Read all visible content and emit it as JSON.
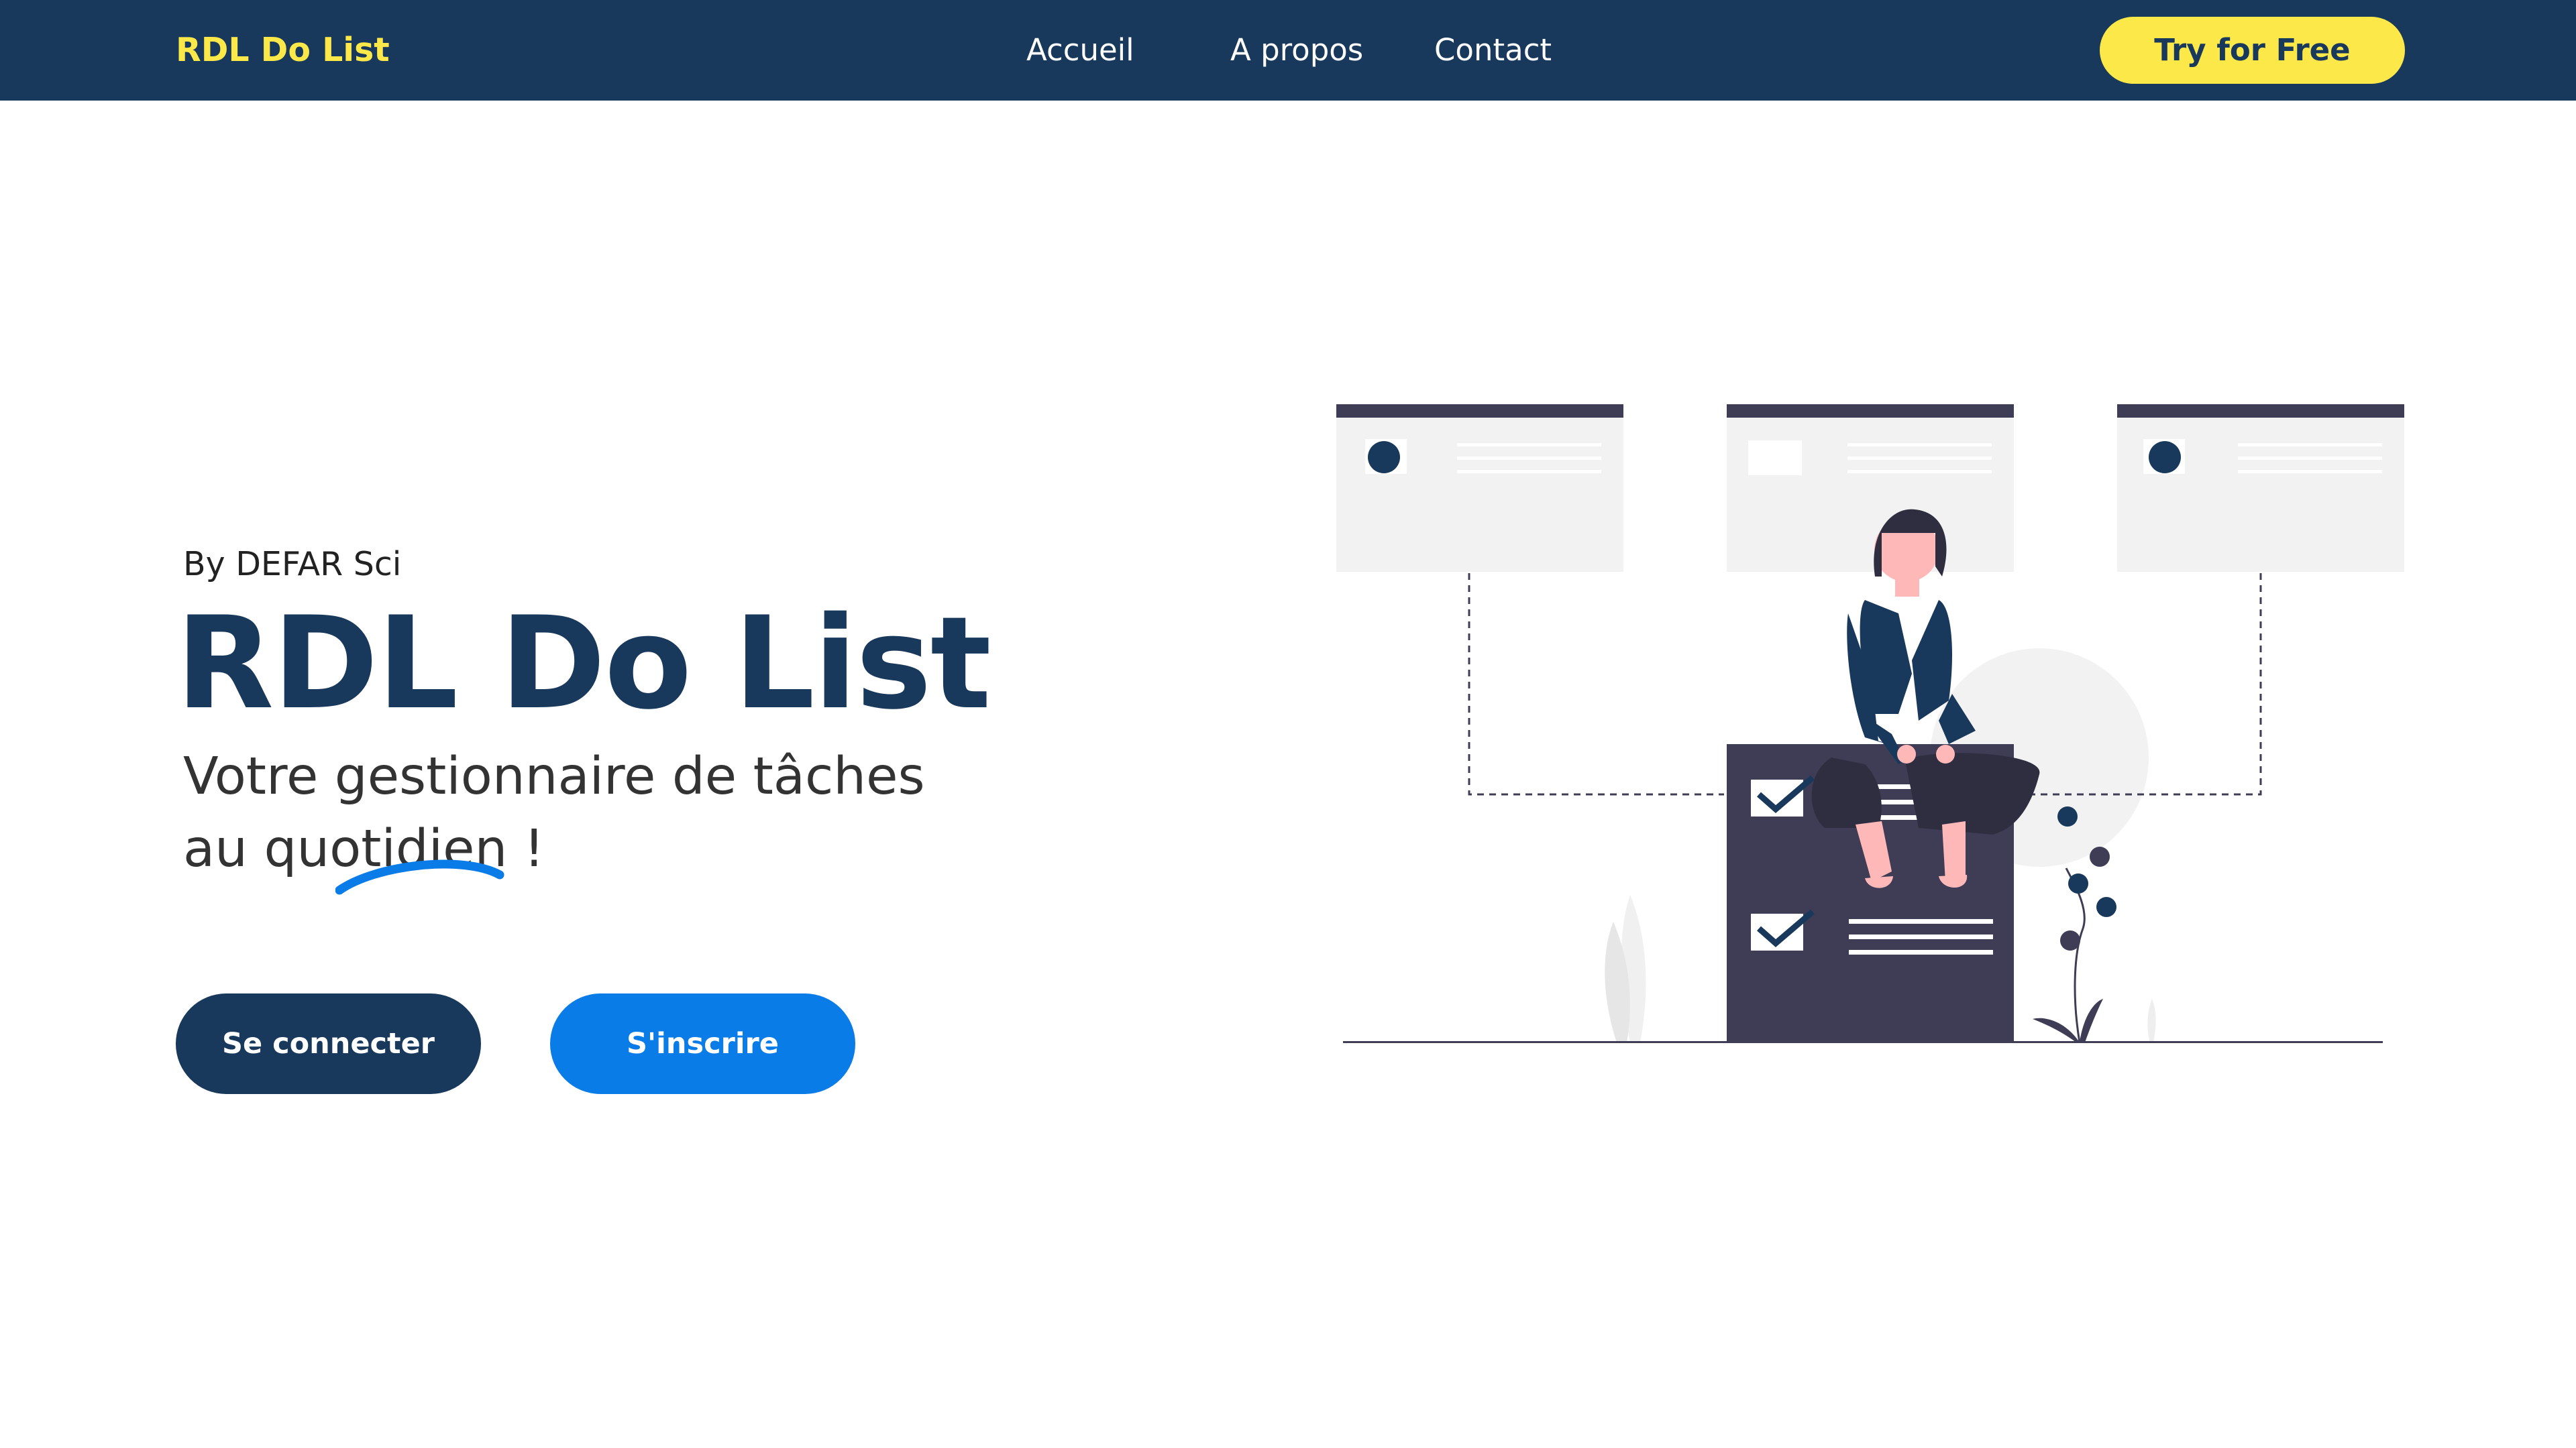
{
  "nav": {
    "brand": "RDL Do List",
    "links": [
      "Accueil",
      "A propos",
      "Contact"
    ],
    "cta": "Try for Free"
  },
  "hero": {
    "byline": "By DEFAR Sci",
    "title": "RDL Do List",
    "subtitle_line1": "Votre gestionnaire de tâches",
    "subtitle_line2": "au quotidien !",
    "login_button": "Se connecter",
    "signup_button": "S'inscrire"
  },
  "colors": {
    "nav_bg": "#18395b",
    "brand_yellow": "#fde84a",
    "accent_blue": "#0a7ce8",
    "illustration_dark": "#3f3d56"
  },
  "illustration": {
    "icon": "woman-sitting-on-task-list-illustration"
  }
}
